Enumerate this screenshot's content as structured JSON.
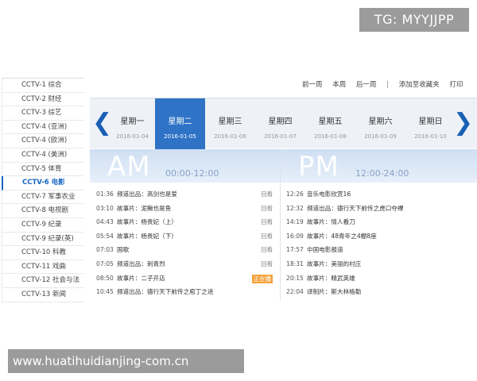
{
  "watermarks": {
    "top": "TG: MYYJJPP",
    "bottom": "www.huatihuidianjing-com.cn"
  },
  "channels": [
    {
      "label": "CCTV-1 综合",
      "active": false
    },
    {
      "label": "CCTV-2 财经",
      "active": false
    },
    {
      "label": "CCTV-3 综艺",
      "active": false
    },
    {
      "label": "CCTV-4 (亚洲)",
      "active": false
    },
    {
      "label": "CCTV-4 (欧洲)",
      "active": false
    },
    {
      "label": "CCTV-4 (美洲)",
      "active": false
    },
    {
      "label": "CCTV-5 体育",
      "active": false
    },
    {
      "label": "CCTV-6 电影",
      "active": true
    },
    {
      "label": "CCTV-7 军事农业",
      "active": false
    },
    {
      "label": "CCTV-8 电视剧",
      "active": false
    },
    {
      "label": "CCTV-9 纪录",
      "active": false
    },
    {
      "label": "CCTV-9 纪录(英)",
      "active": false
    },
    {
      "label": "CCTV-10 科教",
      "active": false
    },
    {
      "label": "CCTV-11 戏曲",
      "active": false
    },
    {
      "label": "CCTV-12 社会与法",
      "active": false
    },
    {
      "label": "CCTV-13 新闻",
      "active": false
    }
  ],
  "toplinks": {
    "prev_week": "前一周",
    "this_week": "本周",
    "next_week": "后一周",
    "separator": "|",
    "favorite": "添加至收藏夹",
    "print": "打印"
  },
  "week": {
    "prev_arrow": "❮",
    "next_arrow": "❯",
    "days": [
      {
        "name": "星期一",
        "date": "2016-01-04",
        "active": false
      },
      {
        "name": "星期二",
        "date": "2016-01-05",
        "active": true
      },
      {
        "name": "星期三",
        "date": "2016-01-06",
        "active": false
      },
      {
        "name": "星期四",
        "date": "2016-01-07",
        "active": false
      },
      {
        "name": "星期五",
        "date": "2016-01-08",
        "active": false
      },
      {
        "name": "星期六",
        "date": "2016-01-09",
        "active": false
      },
      {
        "name": "星期日",
        "date": "2016-01-10",
        "active": false
      }
    ]
  },
  "am": {
    "label": "AM",
    "range": "00:00-12:00"
  },
  "pm": {
    "label": "PM",
    "range": "12:00-24:00"
  },
  "am_programs": [
    {
      "time": "01:36",
      "name": "频道出品：高剑也是爱",
      "action": "回看",
      "live": false
    },
    {
      "time": "03:10",
      "name": "故事片：泥鳅也是鱼",
      "action": "回看",
      "live": false
    },
    {
      "time": "04:43",
      "name": "故事片：杨贵妃（上）",
      "action": "回看",
      "live": false
    },
    {
      "time": "05:54",
      "name": "故事片：杨贵妃（下）",
      "action": "回看",
      "live": false
    },
    {
      "time": "07:03",
      "name": "国歌",
      "action": "回看",
      "live": false
    },
    {
      "time": "07:05",
      "name": "频道出品：刺青烈",
      "action": "回看",
      "live": false
    },
    {
      "time": "08:50",
      "name": "故事片：二子开店",
      "action": "正在播",
      "live": true
    },
    {
      "time": "10:45",
      "name": "频道出品：德行天下前传之庖丁之进",
      "action": "",
      "live": false
    }
  ],
  "pm_programs": [
    {
      "time": "12:26",
      "name": "音乐电影欣赏16"
    },
    {
      "time": "12:32",
      "name": "频道出品：德行天下前传之虎口夺裸"
    },
    {
      "time": "14:19",
      "name": "故事片：情人看刀"
    },
    {
      "time": "16:09",
      "name": "故事片：48青年之4棚8座"
    },
    {
      "time": "17:57",
      "name": "中国电影报道"
    },
    {
      "time": "18:31",
      "name": "故事片：美丽的村庄"
    },
    {
      "time": "20:15",
      "name": "故事片：精武英雄"
    },
    {
      "time": "22:04",
      "name": "译制片：斯大林格勒"
    }
  ]
}
